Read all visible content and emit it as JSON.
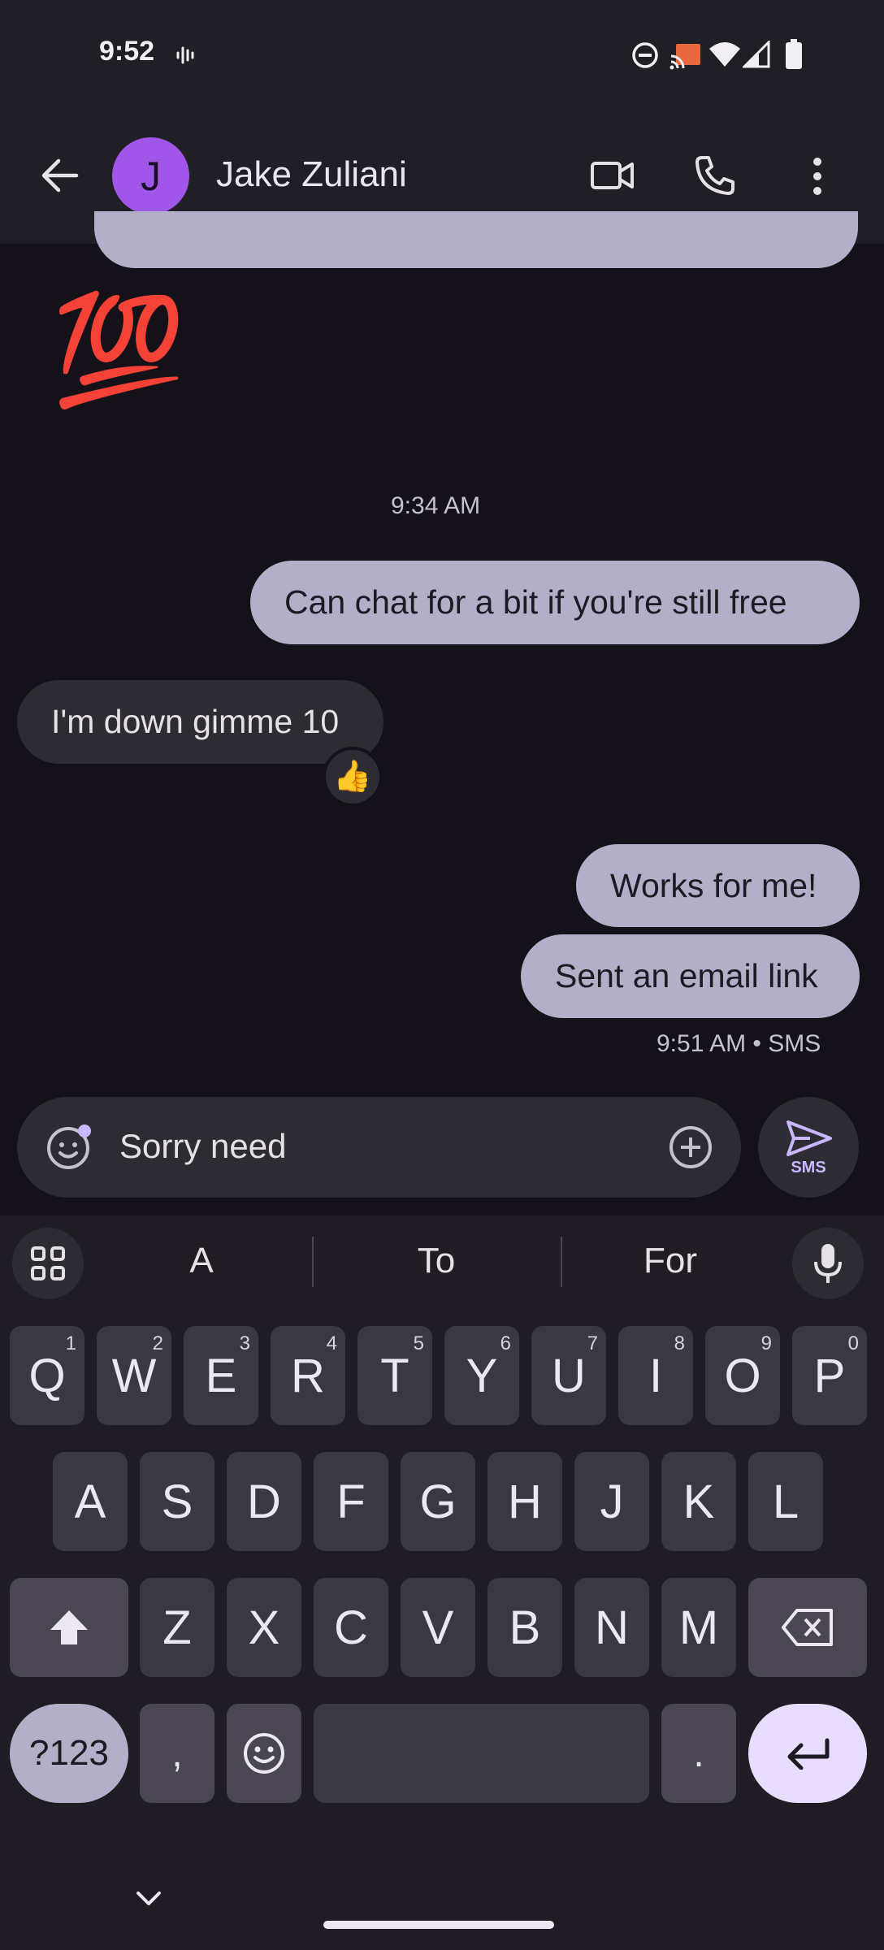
{
  "status": {
    "time": "9:52"
  },
  "header": {
    "contact_name": "Jake Zuliani",
    "avatar_initial": "J",
    "avatar_color": "#a056e8"
  },
  "messages": {
    "emoji_message": "💯",
    "timestamp_1": "9:34 AM",
    "out_1": "Can chat for a bit if you're still free",
    "in_1": "I'm down gimme 10",
    "reaction_1": "👍",
    "out_2": "Works for me!",
    "out_3": "Sent an email link",
    "timestamp_2": "9:51 AM • SMS"
  },
  "compose": {
    "value": "Sorry need",
    "send_label": "SMS"
  },
  "keyboard": {
    "suggestions": [
      "A",
      "To",
      "For"
    ],
    "row1": [
      [
        "Q",
        "1"
      ],
      [
        "W",
        "2"
      ],
      [
        "E",
        "3"
      ],
      [
        "R",
        "4"
      ],
      [
        "T",
        "5"
      ],
      [
        "Y",
        "6"
      ],
      [
        "U",
        "7"
      ],
      [
        "I",
        "8"
      ],
      [
        "O",
        "9"
      ],
      [
        "P",
        "0"
      ]
    ],
    "row2": [
      "A",
      "S",
      "D",
      "F",
      "G",
      "H",
      "J",
      "K",
      "L"
    ],
    "row3": [
      "Z",
      "X",
      "C",
      "V",
      "B",
      "N",
      "M"
    ],
    "symbols_label": "?123",
    "comma": ",",
    "period": "."
  },
  "colors": {
    "bubble_out": "#b3afc8",
    "bubble_in": "#2e2c33",
    "accent": "#c8b6ff",
    "enter_key": "#e8dcff"
  }
}
